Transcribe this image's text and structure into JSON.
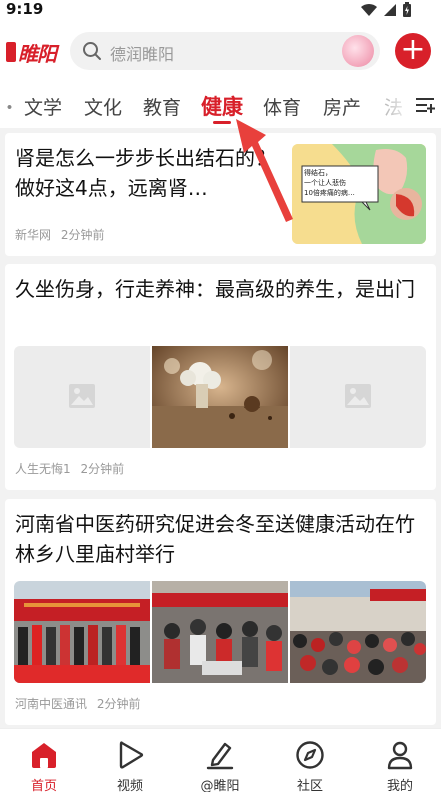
{
  "status": {
    "time": "9:19"
  },
  "header": {
    "logo_text": "睢阳",
    "search_placeholder": "德润睢阳"
  },
  "tabs": [
    {
      "label": "文学"
    },
    {
      "label": "文化"
    },
    {
      "label": "教育"
    },
    {
      "label": "健康",
      "active": true
    },
    {
      "label": "体育"
    },
    {
      "label": "房产"
    },
    {
      "label": "法"
    }
  ],
  "feed": [
    {
      "title": "肾是怎么一步步长出结石的？做好这4点，远离肾…",
      "source": "新华网",
      "time": "2分钟前",
      "thumbnail_caption": [
        "得结石，",
        "一个让人悲伤",
        "10倍疼痛的病…"
      ]
    },
    {
      "title": "久坐伤身，行走养神：最高级的养生，是出门",
      "source": "人生无悔1",
      "time": "2分钟前"
    },
    {
      "title": "河南省中医药研究促进会冬至送健康活动在竹林乡八里庙村举行",
      "source": "河南中医通讯",
      "time": "2分钟前"
    }
  ],
  "bottom_nav": [
    {
      "label": "首页",
      "icon": "home-icon",
      "active": true
    },
    {
      "label": "视频",
      "icon": "play-icon"
    },
    {
      "label": "@睢阳",
      "icon": "edit-icon"
    },
    {
      "label": "社区",
      "icon": "compass-icon"
    },
    {
      "label": "我的",
      "icon": "user-icon"
    }
  ],
  "colors": {
    "accent": "#d8202a"
  }
}
